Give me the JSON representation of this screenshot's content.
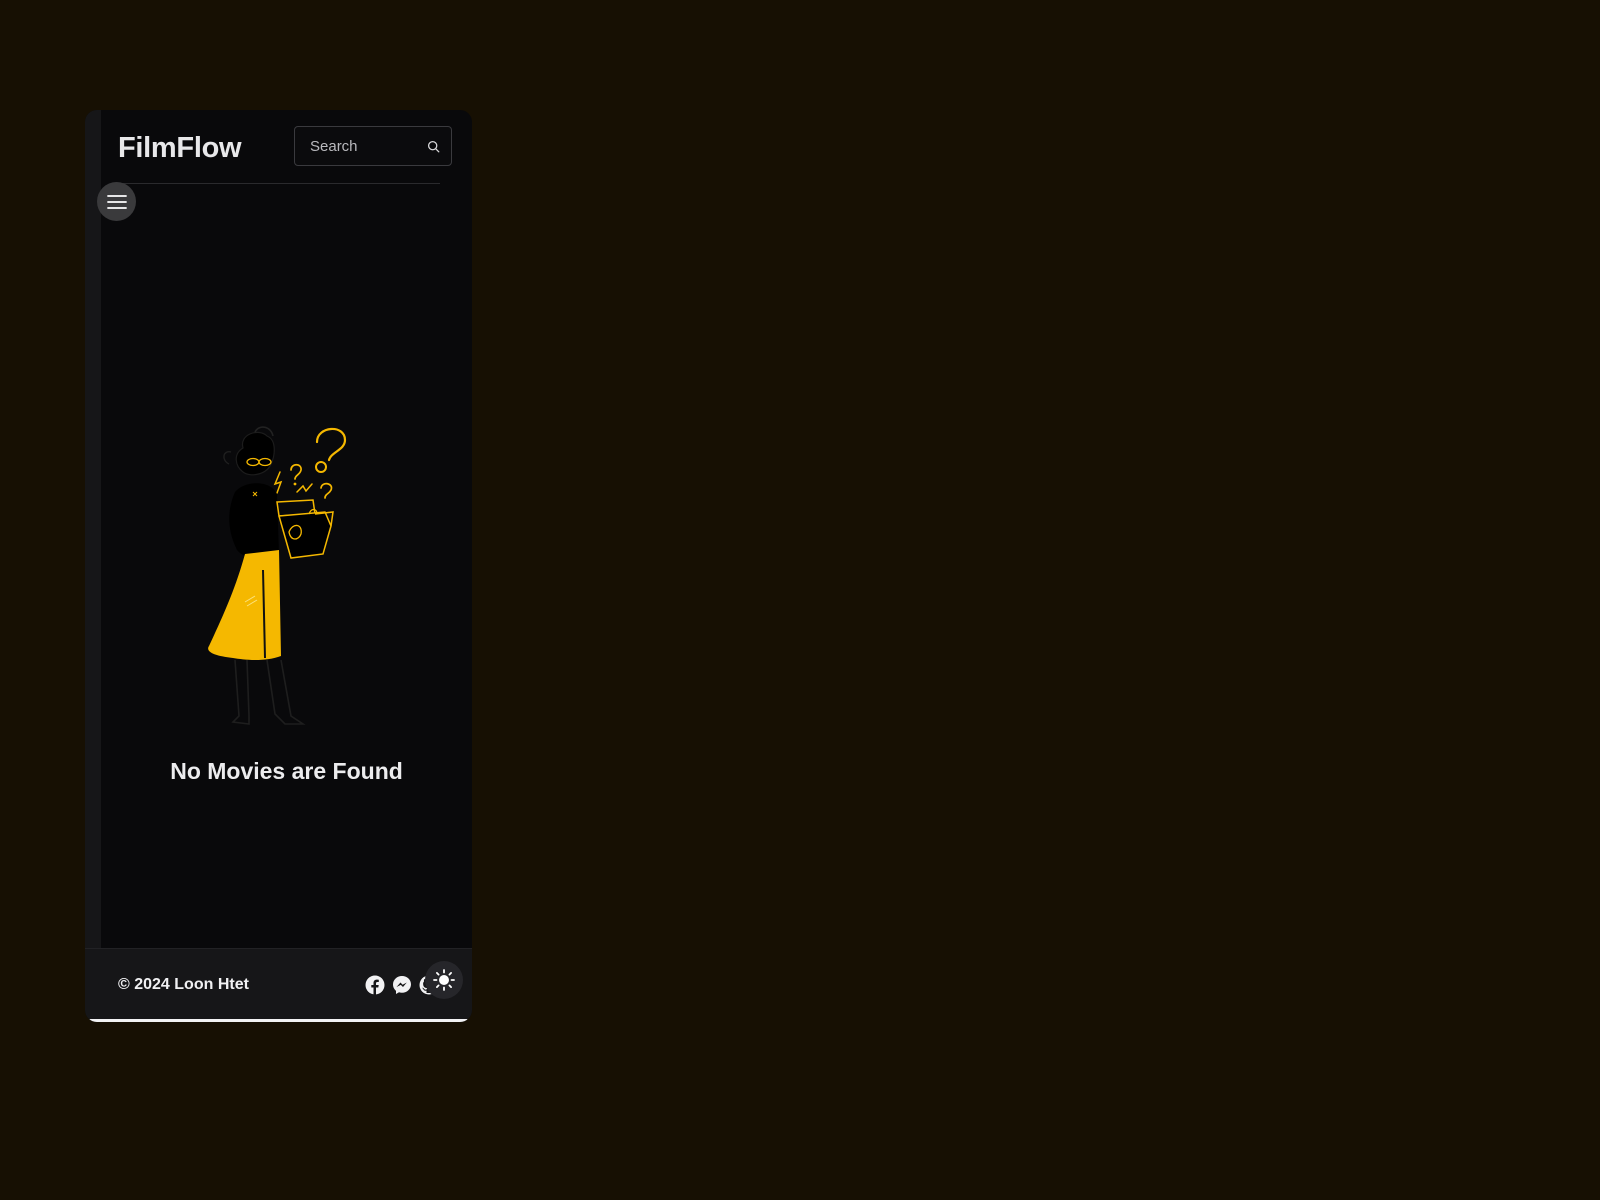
{
  "app": {
    "brand": "FilmFlow"
  },
  "search": {
    "placeholder": "Search",
    "value": "",
    "icon": "search-icon"
  },
  "nav": {
    "menu_icon": "hamburger-menu-icon"
  },
  "empty_state": {
    "illustration": "person-with-box-question-marks",
    "message": "No Movies are Found"
  },
  "footer": {
    "copyright": "© 2024 Loon Htet",
    "social_icons": [
      "facebook-icon",
      "messenger-icon",
      "github-icon"
    ],
    "theme_icon": "sun-icon"
  },
  "colors": {
    "page_background": "#171003",
    "app_background": "#09090b",
    "panel": "#161618",
    "accent": "#f5b800",
    "text": "#ececee"
  }
}
